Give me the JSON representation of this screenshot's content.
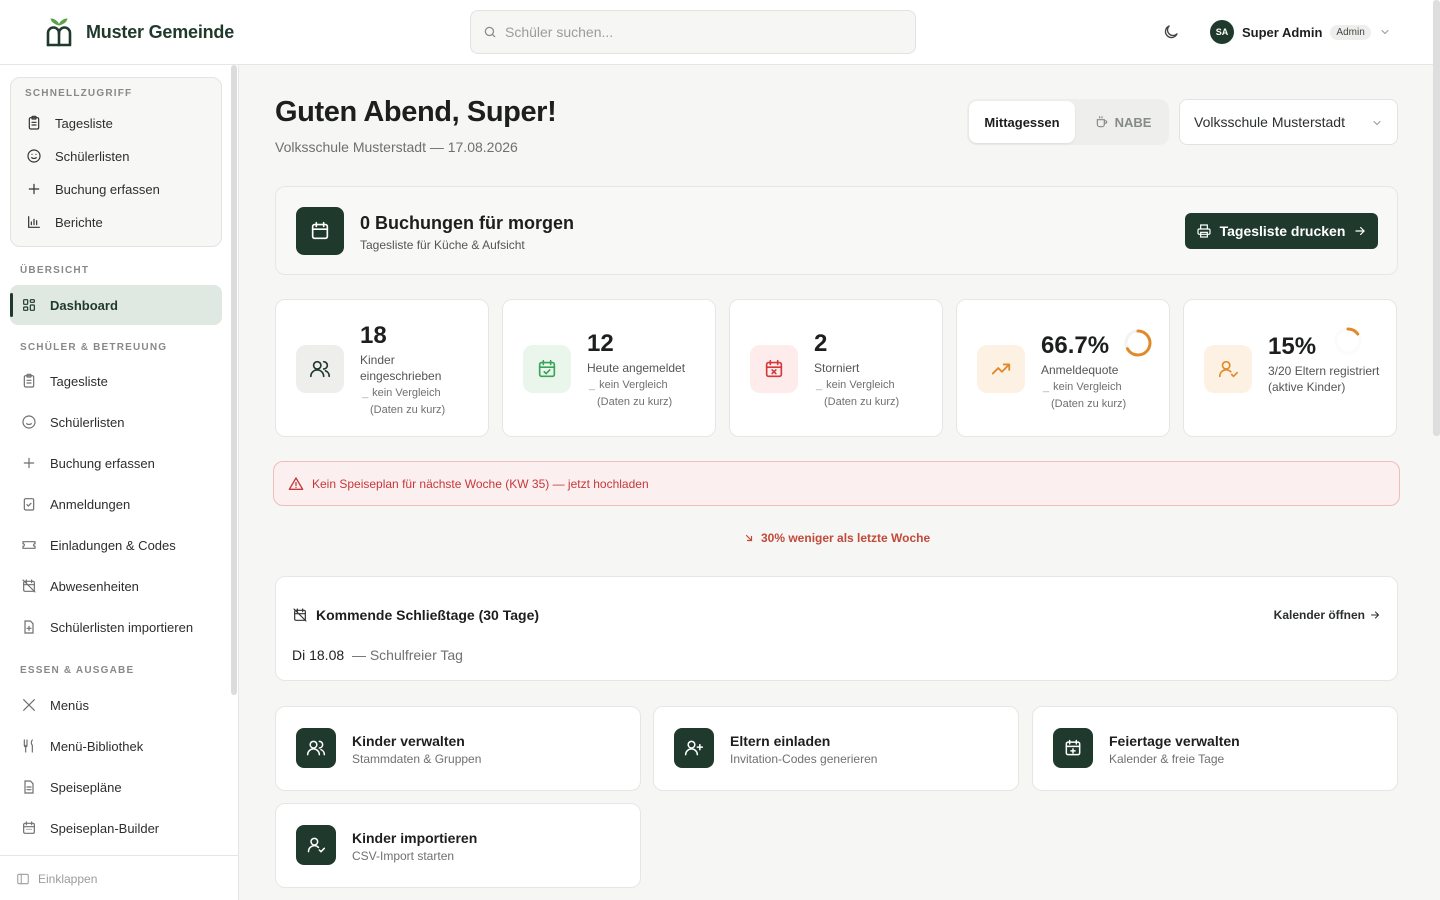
{
  "app": {
    "name": "Muster Gemeinde"
  },
  "header": {
    "search_placeholder": "Schüler suchen...",
    "user_initials": "SA",
    "user_name": "Super Admin",
    "user_role": "Admin"
  },
  "sidebar": {
    "quick": {
      "title": "SCHNELLZUGRIFF",
      "items": [
        "Tagesliste",
        "Schülerlisten",
        "Buchung erfassen",
        "Berichte"
      ]
    },
    "overview": {
      "title": "ÜBERSICHT",
      "items": [
        "Dashboard"
      ]
    },
    "students": {
      "title": "SCHÜLER & BETREUUNG",
      "items": [
        "Tagesliste",
        "Schülerlisten",
        "Buchung erfassen",
        "Anmeldungen",
        "Einladungen & Codes",
        "Abwesenheiten",
        "Schülerlisten importieren"
      ]
    },
    "food": {
      "title": "ESSEN & AUSGABE",
      "items": [
        "Menüs",
        "Menü-Bibliothek",
        "Speisepläne",
        "Speiseplan-Builder"
      ]
    },
    "collapse_label": "Einklappen"
  },
  "main": {
    "greeting": "Guten Abend, Super!",
    "subtitle": "Volksschule Musterstadt — 17.08.2026",
    "toggle": {
      "active": "Mittagessen",
      "inactive": "NABE"
    },
    "school_select": "Volksschule Musterstadt",
    "banner": {
      "title": "0 Buchungen für morgen",
      "subtitle": "Tagesliste für Küche & Aufsicht",
      "button": "Tagesliste drucken"
    },
    "stats": [
      {
        "value": "18",
        "label": "Kinder eingeschrieben",
        "compare_1": "kein Vergleich",
        "compare_2": "(Daten zu kurz)"
      },
      {
        "value": "12",
        "label": "Heute angemeldet",
        "compare_1": "kein Vergleich",
        "compare_2": "(Daten zu kurz)"
      },
      {
        "value": "2",
        "label": "Storniert",
        "compare_1": "kein Vergleich",
        "compare_2": "(Daten zu kurz)"
      },
      {
        "value": "66.7%",
        "label": "Anmeldequote",
        "compare_1": "kein Vergleich",
        "compare_2": "(Daten zu kurz)",
        "progress": 0.667
      },
      {
        "value": "15%",
        "label": "3/20 Eltern registriert (aktive Kinder)",
        "progress": 0.15
      }
    ],
    "alert": "Kein Speiseplan für nächste Woche (KW 35) — jetzt hochladen",
    "trend": "30% weniger als letzte Woche",
    "closing": {
      "title": "Kommende Schließtage (30 Tage)",
      "link": "Kalender öffnen",
      "date": "Di 18.08",
      "description": "— Schulfreier Tag"
    },
    "actions": [
      {
        "title": "Kinder verwalten",
        "subtitle": "Stammdaten & Gruppen"
      },
      {
        "title": "Eltern einladen",
        "subtitle": "Invitation-Codes generieren"
      },
      {
        "title": "Feiertage verwalten",
        "subtitle": "Kalender & freie Tage"
      },
      {
        "title": "Kinder importieren",
        "subtitle": "CSV-Import starten"
      }
    ]
  },
  "colors": {
    "brand": "#1f3a2c",
    "green_soft": "#eaf6ec",
    "red_soft": "#fdeceb",
    "orange_soft": "#fdf1e3",
    "alert_red": "#c5383a"
  }
}
